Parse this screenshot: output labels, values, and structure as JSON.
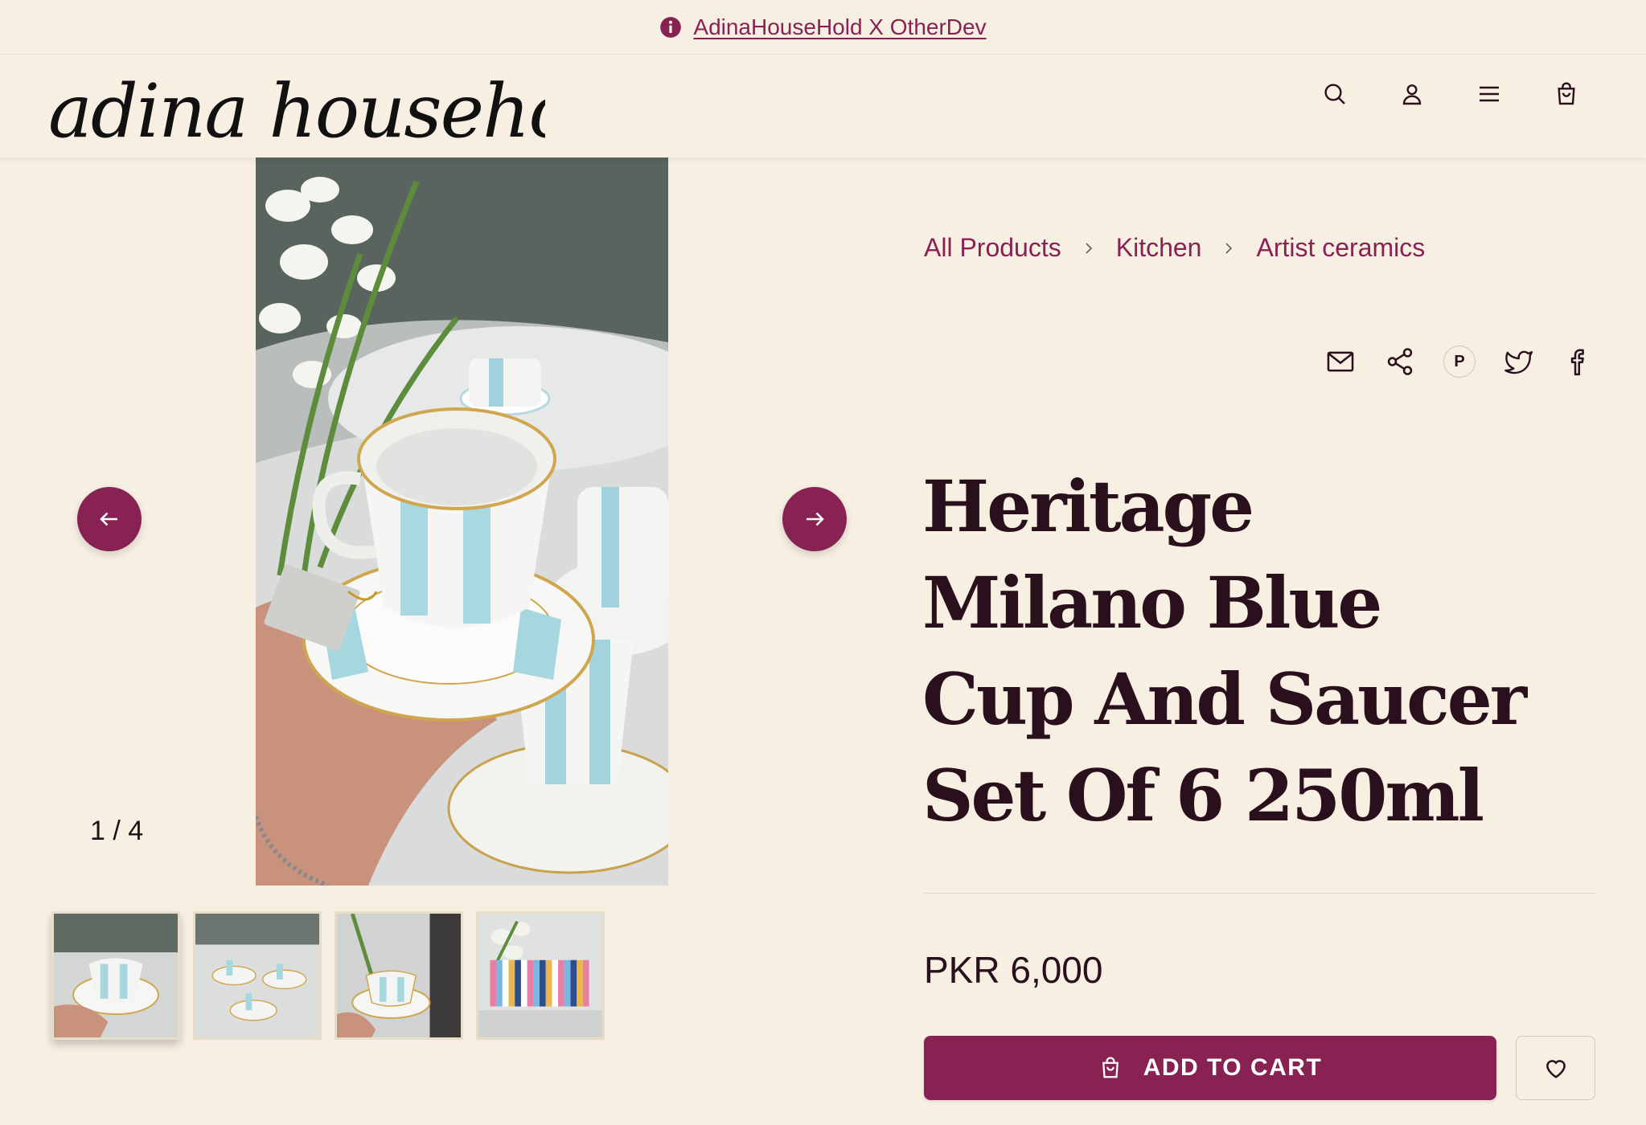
{
  "announcement": {
    "text": "AdinaHouseHold X OtherDev",
    "icon": "info-icon"
  },
  "brand": {
    "logo_text": "adina household"
  },
  "header": {
    "icons": [
      "search-icon",
      "account-icon",
      "menu-icon",
      "cart-icon"
    ]
  },
  "gallery": {
    "counter": "1 / 4",
    "thumbnail_count": 4,
    "active_index": 0
  },
  "breadcrumb": {
    "items": [
      "All Products",
      "Kitchen",
      "Artist ceramics"
    ]
  },
  "share": {
    "icons": [
      "email-icon",
      "share-icon",
      "pinterest-icon",
      "twitter-icon",
      "facebook-icon"
    ],
    "pinterest_letter": "P"
  },
  "product": {
    "title": "Heritage Milano Blue Cup And Saucer Set Of 6 250ml",
    "price": "PKR 6,000",
    "add_to_cart_label": "ADD TO CART"
  },
  "colors": {
    "background": "#f8efe3",
    "accent": "#872252",
    "text": "#2a0f1c"
  }
}
